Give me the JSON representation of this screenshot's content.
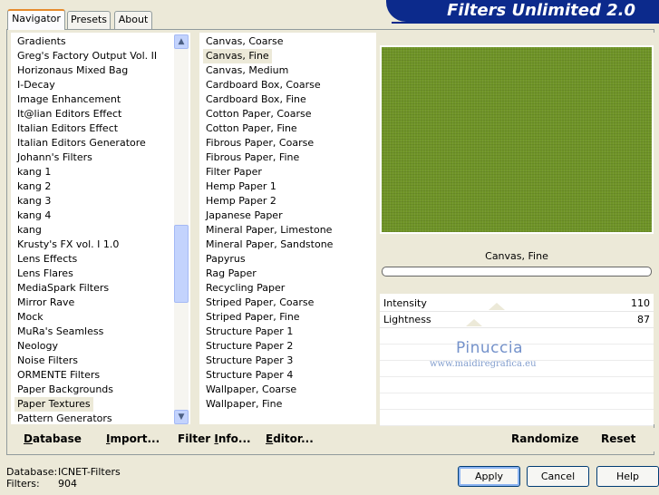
{
  "tabs": [
    "Navigator",
    "Presets",
    "About"
  ],
  "banner": {
    "title": "Filters Unlimited 2.0"
  },
  "categories": {
    "items": [
      "Gradients",
      "Greg's Factory Output Vol. II",
      "Horizonaus Mixed Bag",
      "I-Decay",
      "Image Enhancement",
      "It@lian Editors Effect",
      "Italian Editors Effect",
      "Italian Editors Generatore",
      "Johann's Filters",
      "kang 1",
      "kang 2",
      "kang 3",
      "kang 4",
      "kang",
      "Krusty's FX vol. I 1.0",
      "Lens Effects",
      "Lens Flares",
      "MediaSpark Filters",
      "Mirror Rave",
      "Mock",
      "MuRa's Seamless",
      "Neology",
      "Noise Filters",
      "ORMENTE Filters",
      "Paper Backgrounds",
      "Paper Textures",
      "Pattern Generators"
    ],
    "selected": "Paper Textures"
  },
  "filters": {
    "items": [
      "Canvas, Coarse",
      "Canvas, Fine",
      "Canvas, Medium",
      "Cardboard Box, Coarse",
      "Cardboard Box, Fine",
      "Cotton Paper, Coarse",
      "Cotton Paper, Fine",
      "Fibrous Paper, Coarse",
      "Fibrous Paper, Fine",
      "Filter Paper",
      "Hemp Paper 1",
      "Hemp Paper 2",
      "Japanese Paper",
      "Mineral Paper, Limestone",
      "Mineral Paper, Sandstone",
      "Papyrus",
      "Rag Paper",
      "Recycling Paper",
      "Striped Paper, Coarse",
      "Striped Paper, Fine",
      "Structure Paper 1",
      "Structure Paper 2",
      "Structure Paper 3",
      "Structure Paper 4",
      "Wallpaper, Coarse",
      "Wallpaper, Fine"
    ],
    "selected": "Canvas, Fine"
  },
  "left_buttons": {
    "database": "Database",
    "import": "Import...",
    "filter_info": "Filter Info...",
    "editor": "Editor..."
  },
  "right_buttons": {
    "randomize": "Randomize",
    "reset": "Reset"
  },
  "preview": {
    "filter_name": "Canvas, Fine",
    "texture_color": "#6f9427"
  },
  "sliders": [
    {
      "label": "Intensity",
      "value": "110"
    },
    {
      "label": "Lightness",
      "value": "87"
    }
  ],
  "watermark": {
    "name": "Pinuccia",
    "url": "www.maidiregrafica.eu"
  },
  "status": {
    "database_label": "Database:",
    "database_value": "ICNET-Filters",
    "filters_label": "Filters:",
    "filters_value": "904"
  },
  "dialog_buttons": {
    "apply": "Apply",
    "cancel": "Cancel",
    "help": "Help"
  }
}
